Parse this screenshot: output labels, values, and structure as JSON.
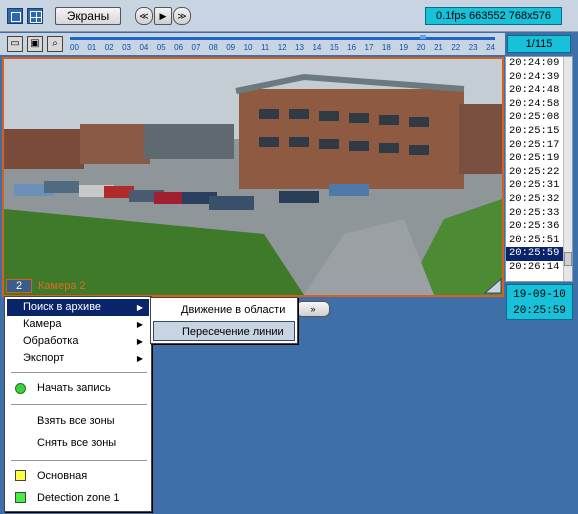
{
  "toolbar": {
    "screens_label": "Экраны",
    "nav_prev": "≪",
    "nav_play": "▶",
    "nav_next": "≫",
    "status": "0.1fps 663552 768x576"
  },
  "timeline": {
    "ticks": [
      "00",
      "01",
      "02",
      "03",
      "04",
      "05",
      "06",
      "07",
      "08",
      "09",
      "10",
      "11",
      "12",
      "13",
      "14",
      "15",
      "16",
      "17",
      "18",
      "19",
      "20",
      "21",
      "22",
      "23",
      "24"
    ],
    "counter": "1/115"
  },
  "camera": {
    "number": "2",
    "label": "Камера 2"
  },
  "timelist": {
    "items": [
      "20:24:09",
      "20:24:39",
      "20:24:48",
      "20:24:58",
      "20:25:08",
      "20:25:15",
      "20:25:17",
      "20:25:19",
      "20:25:22",
      "20:25:31",
      "20:25:32",
      "20:25:33",
      "20:25:36",
      "20:25:51",
      "20:25:59",
      "20:26:14"
    ],
    "selected_index": 14
  },
  "datetime": {
    "date": "19-09-10",
    "time": "20:25:59"
  },
  "menu": {
    "items": [
      {
        "label": "Поиск в архиве",
        "submenu": true,
        "highlighted": true
      },
      {
        "label": "Камера",
        "submenu": true
      },
      {
        "label": "Обработка",
        "submenu": true
      },
      {
        "label": "Экспорт",
        "submenu": true
      }
    ],
    "record_label": "Начать запись",
    "take_zones": "Взять все зоны",
    "release_zones": "Снять все зоны",
    "zone_main": "Основная",
    "zone_detection": "Detection zone 1"
  },
  "submenu": {
    "items": [
      {
        "label": "Движение в области"
      },
      {
        "label": "Пересечение линии",
        "highlighted": true
      }
    ]
  },
  "colors": {
    "background": "#3f6fa8",
    "accent_cyan": "#16c1d9",
    "camera_border": "#d9601a",
    "selection": "#0a246a",
    "zone_main": "#ffff44",
    "zone_detection": "#44ee44"
  }
}
